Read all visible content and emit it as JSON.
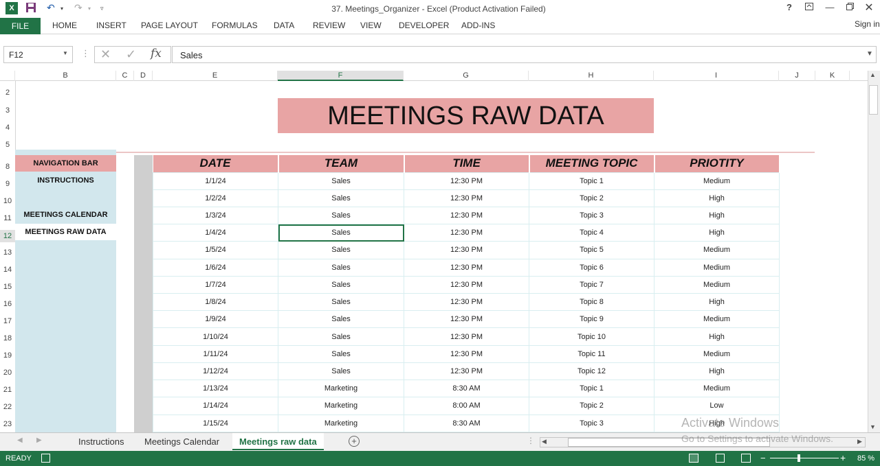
{
  "window": {
    "title": "37. Meetings_Organizer - Excel (Product Activation Failed)",
    "sign_in": "Sign in",
    "help": "?"
  },
  "ribbon": {
    "file": "FILE",
    "tabs": [
      "HOME",
      "INSERT",
      "PAGE LAYOUT",
      "FORMULAS",
      "DATA",
      "REVIEW",
      "VIEW",
      "DEVELOPER",
      "ADD-INS"
    ]
  },
  "formula_bar": {
    "name_box": "F12",
    "fx": "fx",
    "value": "Sales"
  },
  "columns": [
    "B",
    "C",
    "D",
    "E",
    "F",
    "G",
    "H",
    "I",
    "J",
    "K"
  ],
  "rows": [
    "2",
    "3",
    "4",
    "5",
    "8",
    "9",
    "10",
    "11",
    "12",
    "13",
    "14",
    "15",
    "16",
    "17",
    "18",
    "19",
    "20",
    "21",
    "22",
    "23"
  ],
  "sheet": {
    "banner": "MEETINGS RAW DATA",
    "nav": {
      "title": "NAVIGATION BAR",
      "items": [
        "INSTRUCTIONS",
        "MEETINGS CALENDAR",
        "MEETINGS RAW DATA"
      ]
    },
    "table": {
      "headers": [
        "DATE",
        "TEAM",
        "TIME",
        "MEETING TOPIC",
        "PRIOTITY"
      ],
      "rows": [
        [
          "1/1/24",
          "Sales",
          "12:30 PM",
          "Topic 1",
          "Medium"
        ],
        [
          "1/2/24",
          "Sales",
          "12:30 PM",
          "Topic 2",
          "High"
        ],
        [
          "1/3/24",
          "Sales",
          "12:30 PM",
          "Topic 3",
          "High"
        ],
        [
          "1/4/24",
          "Sales",
          "12:30 PM",
          "Topic 4",
          "High"
        ],
        [
          "1/5/24",
          "Sales",
          "12:30 PM",
          "Topic 5",
          "Medium"
        ],
        [
          "1/6/24",
          "Sales",
          "12:30 PM",
          "Topic 6",
          "Medium"
        ],
        [
          "1/7/24",
          "Sales",
          "12:30 PM",
          "Topic 7",
          "Medium"
        ],
        [
          "1/8/24",
          "Sales",
          "12:30 PM",
          "Topic 8",
          "High"
        ],
        [
          "1/9/24",
          "Sales",
          "12:30 PM",
          "Topic 9",
          "Medium"
        ],
        [
          "1/10/24",
          "Sales",
          "12:30 PM",
          "Topic 10",
          "High"
        ],
        [
          "1/11/24",
          "Sales",
          "12:30 PM",
          "Topic 11",
          "Medium"
        ],
        [
          "1/12/24",
          "Sales",
          "12:30 PM",
          "Topic 12",
          "High"
        ],
        [
          "1/13/24",
          "Marketing",
          "8:30 AM",
          "Topic 1",
          "Medium"
        ],
        [
          "1/14/24",
          "Marketing",
          "8:00 AM",
          "Topic 2",
          "Low"
        ],
        [
          "1/15/24",
          "Marketing",
          "8:30 AM",
          "Topic 3",
          "High"
        ]
      ]
    }
  },
  "sheet_tabs": [
    "Instructions",
    "Meetings Calendar",
    "Meetings raw data"
  ],
  "active_sheet_tab": "Meetings raw data",
  "status": {
    "ready": "READY",
    "zoom": "85 %"
  },
  "watermark": {
    "line1": "Activate Windows",
    "line2": "Go to Settings to activate Windows."
  },
  "colors": {
    "excel_green": "#217346",
    "header_pink": "#e8a4a4",
    "nav_blue": "#d2e7ed"
  }
}
